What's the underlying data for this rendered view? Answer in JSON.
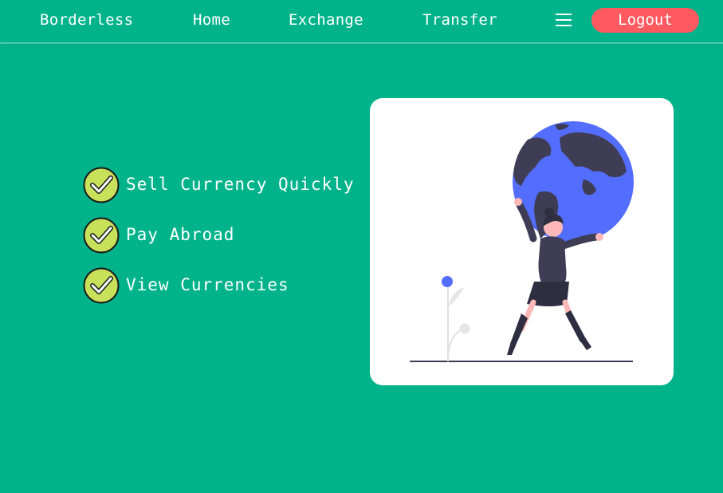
{
  "nav": {
    "brand": "Borderless",
    "links": [
      "Home",
      "Exchange",
      "Transfer"
    ],
    "menu_icon": "hamburger-menu-icon",
    "logout_label": "Logout"
  },
  "features": [
    {
      "label": "Sell Currency Quickly",
      "icon": "check-circle-icon"
    },
    {
      "label": "Pay Abroad",
      "icon": "check-circle-icon"
    },
    {
      "label": "View Currencies",
      "icon": "check-circle-icon"
    }
  ],
  "illustration": {
    "subject": "woman-holding-globe-illustration"
  },
  "colors": {
    "background": "#00b38a",
    "logout_button": "#ff5a5f",
    "check_fill": "#c8e05a",
    "globe": "#536dfe",
    "figure": "#3f3d56"
  }
}
